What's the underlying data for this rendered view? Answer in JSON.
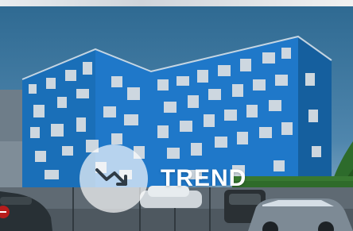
{
  "hero": {
    "title": "TREND",
    "icon": "trend-down-icon",
    "colors": {
      "building_blue": "#1f78c9",
      "building_light": "#d7dde2",
      "sky": "#3a77a0",
      "tree": "#2d6b2b"
    }
  }
}
